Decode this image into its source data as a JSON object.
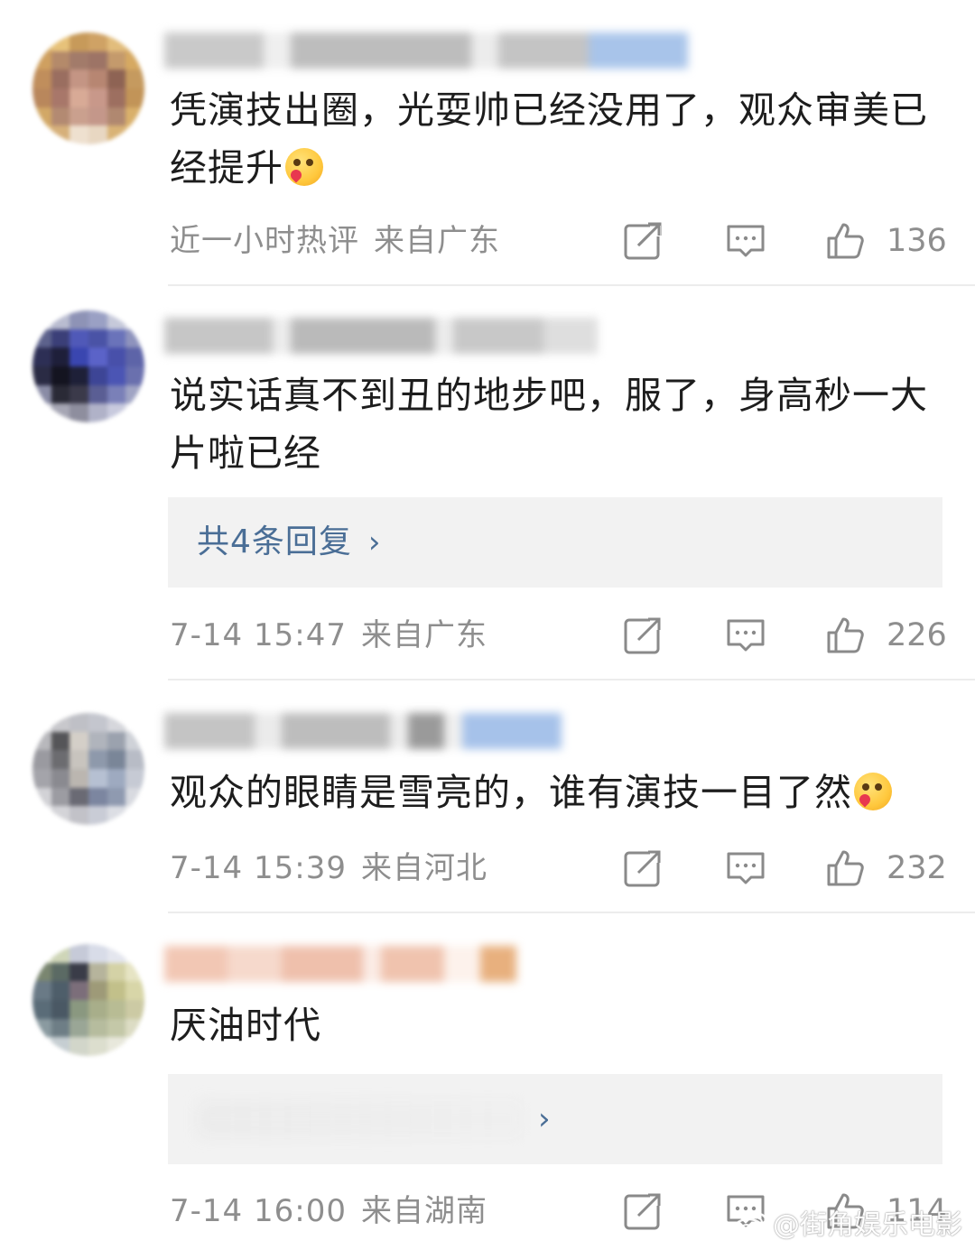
{
  "comments": [
    {
      "text": "凭演技出圈，光耍帅已经没用了，观众审美已经提升",
      "emoji_icon": "drooling-face-emoji-icon",
      "time": "近一小时热评",
      "location": "来自广东",
      "likes": "136"
    },
    {
      "text": "说实话真不到丑的地步吧，服了，身高秒一大片啦已经",
      "reply_label": "共4条回复",
      "reply_chevron": "›",
      "time": "7-14 15:47",
      "location": "来自广东",
      "likes": "226"
    },
    {
      "text": "观众的眼睛是雪亮的，谁有演技一目了然",
      "emoji_icon": "kissing-heart-emoji-icon",
      "time": "7-14 15:39",
      "location": "来自河北",
      "likes": "232"
    },
    {
      "text": "厌油时代",
      "reply_chevron": "›",
      "time": "7-14 16:00",
      "location": "来自湖南",
      "likes": "114"
    }
  ],
  "watermark": {
    "text": "@街角娱乐电影",
    "icon": "weibo-logo-icon"
  },
  "colors": {
    "link": "#4a6e96",
    "meta": "#8e8e8e",
    "reply_bg": "#f2f2f2",
    "divider": "#ececec"
  }
}
